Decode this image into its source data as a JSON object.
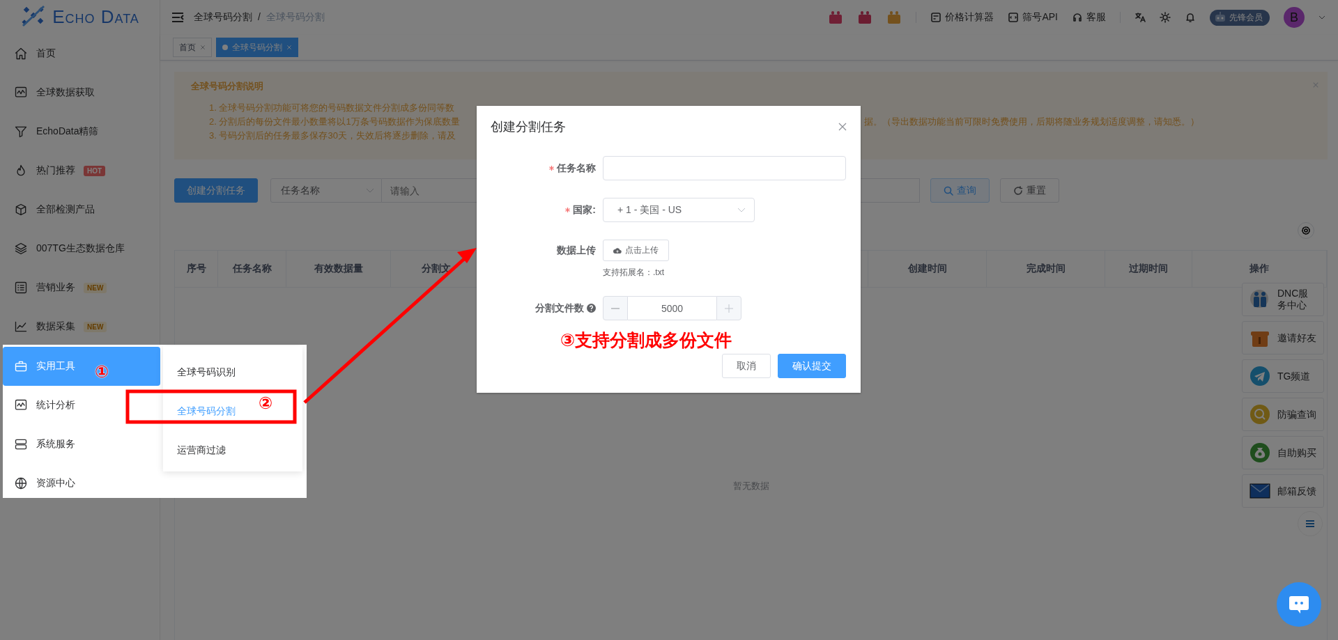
{
  "logo": {
    "text": "Echo Data"
  },
  "sidebar": {
    "items": [
      {
        "label": "首页"
      },
      {
        "label": "全球数据获取"
      },
      {
        "label": "EchoData精筛"
      },
      {
        "label": "热门推荐",
        "badge": {
          "kind": "hot",
          "text": "HOT"
        }
      },
      {
        "label": "全部检测产品"
      },
      {
        "label": "007TG生态数据仓库"
      },
      {
        "label": "营销业务",
        "badge": {
          "kind": "new",
          "text": "NEW"
        }
      },
      {
        "label": "数据采集",
        "badge": {
          "kind": "new",
          "text": "NEW"
        }
      }
    ]
  },
  "flyout_menu": {
    "items": [
      {
        "label": "实用工具",
        "selected": true
      },
      {
        "label": "统计分析",
        "selected": false
      },
      {
        "label": "系统服务",
        "selected": false
      },
      {
        "label": "资源中心",
        "selected": false
      }
    ],
    "submenu": [
      {
        "label": "全球号码识别",
        "selected": false
      },
      {
        "label": "全球号码分割",
        "selected": true
      },
      {
        "label": "运营商过滤",
        "selected": false
      }
    ]
  },
  "header": {
    "breadcrumb": [
      "全球号码分割",
      "全球号码分割"
    ],
    "separator": "/",
    "links": [
      "价格计算器",
      "筛号API",
      "客服"
    ],
    "member_badge": "先锋会员",
    "avatar": "B"
  },
  "tabs": [
    {
      "label": "首页",
      "selected": false
    },
    {
      "label": "全球号码分割",
      "selected": true
    }
  ],
  "notice": {
    "title": "全球号码分割说明",
    "lines": [
      {
        "left": "1. 全球号码分割功能可将您的号码数据文件分割成多份同等数"
      },
      {
        "left": "2. 分割后的每份文件最小数量将以1万条号码数据作为保底数量",
        "right": "据。（导出数据功能当前可限时免费使用，后期将随业务规划适度调整，请知悉。）"
      },
      {
        "left": "3. 号码分割后的任务最多保存30天，失效后将逐步删除，请及"
      }
    ]
  },
  "toolbar": {
    "create_button": "创建分割任务",
    "filter_select": "任务名称",
    "search_placeholder": "请输入",
    "query_button": "查询",
    "reset_button": "重置"
  },
  "table": {
    "columns": [
      "序号",
      "任务名称",
      "有效数据量",
      "分割文",
      "创建时间",
      "完成时间",
      "过期时间",
      "操作"
    ],
    "empty_text": "暂无数据"
  },
  "float_panel": [
    {
      "label": "DNC服务中心"
    },
    {
      "label": "邀请好友"
    },
    {
      "label": "TG频道"
    },
    {
      "label": "防骗查询"
    },
    {
      "label": "自助购买"
    },
    {
      "label": "邮箱反馈"
    }
  ],
  "dialog": {
    "title": "创建分割任务",
    "fields": [
      {
        "kind": "text",
        "label": "任务名称",
        "required": true
      },
      {
        "kind": "select",
        "label": "国家:",
        "required": true,
        "value": "+ 1 - 美国 - US"
      },
      {
        "kind": "upload",
        "label": "数据上传",
        "required": false,
        "button": "点击上传",
        "hint": "支持拓展名：.txt"
      },
      {
        "kind": "number",
        "label": "分割文件数",
        "required": false,
        "help": true,
        "value": "5000"
      }
    ],
    "buttons": [
      {
        "label": "取消",
        "kind": "default"
      },
      {
        "label": "确认提交",
        "kind": "primary"
      }
    ]
  },
  "annotations": {
    "markers": [
      "①",
      "②"
    ],
    "callout": "③支持分割成多份文件"
  }
}
